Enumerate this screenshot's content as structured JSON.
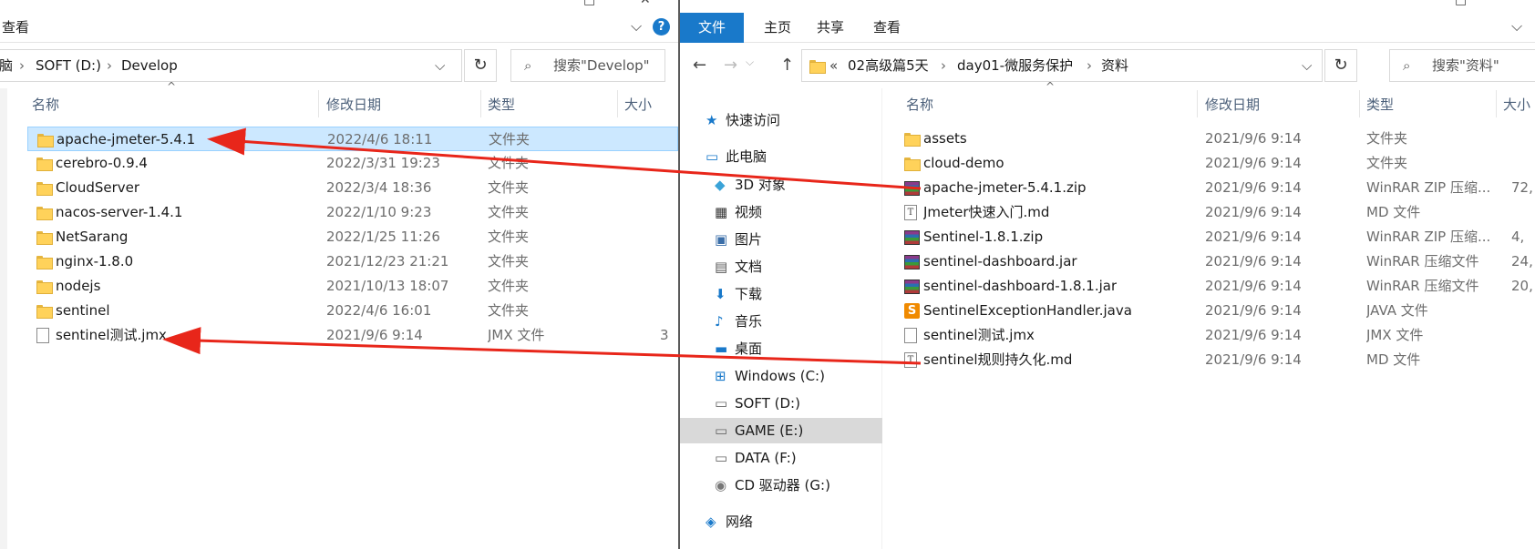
{
  "left": {
    "ribbon_tab": "查看",
    "breadcrumb": [
      "脑",
      "SOFT (D:)",
      "Develop"
    ],
    "search_placeholder": "搜索\"Develop\"",
    "columns": [
      "名称",
      "修改日期",
      "类型",
      "大小"
    ],
    "rows": [
      {
        "name": "apache-jmeter-5.4.1",
        "date": "2022/4/6 18:11",
        "type": "文件夹",
        "size": "",
        "icon": "folder-icon",
        "selected": true
      },
      {
        "name": "cerebro-0.9.4",
        "date": "2022/3/31 19:23",
        "type": "文件夹",
        "size": "",
        "icon": "folder-icon"
      },
      {
        "name": "CloudServer",
        "date": "2022/3/4 18:36",
        "type": "文件夹",
        "size": "",
        "icon": "folder-icon"
      },
      {
        "name": "nacos-server-1.4.1",
        "date": "2022/1/10 9:23",
        "type": "文件夹",
        "size": "",
        "icon": "folder-icon"
      },
      {
        "name": "NetSarang",
        "date": "2022/1/25 11:26",
        "type": "文件夹",
        "size": "",
        "icon": "folder-icon"
      },
      {
        "name": "nginx-1.8.0",
        "date": "2021/12/23 21:21",
        "type": "文件夹",
        "size": "",
        "icon": "folder-icon"
      },
      {
        "name": "nodejs",
        "date": "2021/10/13 18:07",
        "type": "文件夹",
        "size": "",
        "icon": "folder-icon"
      },
      {
        "name": "sentinel",
        "date": "2022/4/6 16:01",
        "type": "文件夹",
        "size": "",
        "icon": "folder-icon"
      },
      {
        "name": "sentinel测试.jmx",
        "date": "2021/9/6 9:14",
        "type": "JMX 文件",
        "size": "3",
        "icon": "file-icon"
      }
    ]
  },
  "right": {
    "ribbon_tabs": [
      "文件",
      "主页",
      "共享",
      "查看"
    ],
    "breadcrumb": [
      "«",
      "02高级篇5天",
      "day01-微服务保护",
      "资料"
    ],
    "search_placeholder": "搜索\"资料\"",
    "columns": [
      "名称",
      "修改日期",
      "类型",
      "大小"
    ],
    "nav": [
      {
        "label": "快速访问",
        "icon": "star-icon"
      },
      {
        "label": "此电脑",
        "icon": "computer-icon"
      },
      {
        "label": "3D 对象",
        "icon": "cube-icon"
      },
      {
        "label": "视频",
        "icon": "video-icon"
      },
      {
        "label": "图片",
        "icon": "picture-icon"
      },
      {
        "label": "文档",
        "icon": "document-icon"
      },
      {
        "label": "下载",
        "icon": "download-icon"
      },
      {
        "label": "音乐",
        "icon": "music-icon"
      },
      {
        "label": "桌面",
        "icon": "desktop-icon"
      },
      {
        "label": "Windows (C:)",
        "icon": "windows-drive-icon"
      },
      {
        "label": "SOFT (D:)",
        "icon": "drive-icon"
      },
      {
        "label": "GAME (E:)",
        "icon": "drive-icon",
        "selected": true
      },
      {
        "label": "DATA (F:)",
        "icon": "drive-icon"
      },
      {
        "label": "CD 驱动器 (G:)",
        "icon": "cd-drive-icon"
      },
      {
        "label": "网络",
        "icon": "network-icon"
      }
    ],
    "rows": [
      {
        "name": "assets",
        "date": "2021/9/6 9:14",
        "type": "文件夹",
        "size": "",
        "icon": "folder-icon"
      },
      {
        "name": "cloud-demo",
        "date": "2021/9/6 9:14",
        "type": "文件夹",
        "size": "",
        "icon": "folder-icon"
      },
      {
        "name": "apache-jmeter-5.4.1.zip",
        "date": "2021/9/6 9:14",
        "type": "WinRAR ZIP 压缩...",
        "size": "72,",
        "icon": "winrar-icon"
      },
      {
        "name": "Jmeter快速入门.md",
        "date": "2021/9/6 9:14",
        "type": "MD 文件",
        "size": "",
        "icon": "md-icon"
      },
      {
        "name": "Sentinel-1.8.1.zip",
        "date": "2021/9/6 9:14",
        "type": "WinRAR ZIP 压缩...",
        "size": "4,",
        "icon": "winrar-icon"
      },
      {
        "name": "sentinel-dashboard.jar",
        "date": "2021/9/6 9:14",
        "type": "WinRAR 压缩文件",
        "size": "24,",
        "icon": "winrar-icon"
      },
      {
        "name": "sentinel-dashboard-1.8.1.jar",
        "date": "2021/9/6 9:14",
        "type": "WinRAR 压缩文件",
        "size": "20,",
        "icon": "winrar-icon"
      },
      {
        "name": "SentinelExceptionHandler.java",
        "date": "2021/9/6 9:14",
        "type": "JAVA 文件",
        "size": "",
        "icon": "java-icon"
      },
      {
        "name": "sentinel测试.jmx",
        "date": "2021/9/6 9:14",
        "type": "JMX 文件",
        "size": "",
        "icon": "file-icon"
      },
      {
        "name": "sentinel规则持久化.md",
        "date": "2021/9/6 9:14",
        "type": "MD 文件",
        "size": "",
        "icon": "md-icon"
      }
    ]
  },
  "colors": {
    "accent": "#1979ca",
    "selection": "#cce8ff",
    "arrow": "#e8261a"
  }
}
